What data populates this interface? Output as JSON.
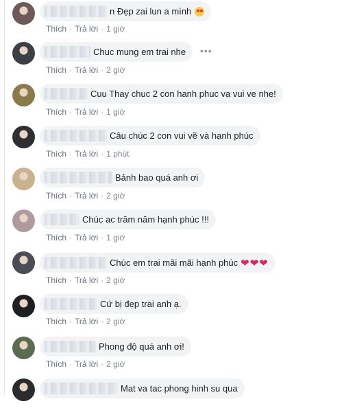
{
  "actions": {
    "like": "Thích",
    "reply": "Trả lời",
    "sep": "·"
  },
  "more_icon": "more-horizontal-icon",
  "comments": [
    {
      "text": "n Đẹp zai lun a mình",
      "time": "1 giờ",
      "blur_w": 92,
      "extra": "heart-eyes-emoji",
      "avatar": "#6d5a58"
    },
    {
      "text": "Chuc mung em trai nhe",
      "time": "2 giờ",
      "blur_w": 68,
      "avatar": "#3c3f44"
    },
    {
      "text": "Cuu Thay chuc 2 con hanh phuc va vui ve nhe!",
      "time": "1 giờ",
      "blur_w": 64,
      "avatar": "#8b7a4a"
    },
    {
      "text": "Câu chúc 2 con vui vẽ và hạnh phúc",
      "time": "1 phút",
      "blur_w": 92,
      "avatar": "#2d2f33"
    },
    {
      "text": "Bảnh bao quá anh ơi",
      "time": "2 giờ",
      "blur_w": 100,
      "avatar": "#c9b38e"
    },
    {
      "text": "Chúc ac trăm năm hạnh phúc !!!",
      "time": "1 giờ",
      "blur_w": 52,
      "avatar": "#b09aa0"
    },
    {
      "text": "Chúc em trai mãi mãi hạnh phúc",
      "time": "2 giờ",
      "blur_w": 92,
      "hearts": "❤❤❤",
      "avatar": "#4a4d55"
    },
    {
      "text": "Cứ bị đẹp trai anh ạ.",
      "time": "2 giờ",
      "blur_w": 78,
      "avatar": "#1e1f22"
    },
    {
      "text": "Phong độ quá anh ơi!",
      "time": "2 giờ",
      "blur_w": 76,
      "avatar": "#5a6b4e"
    },
    {
      "text": "Mat va tac phong hinh su qua",
      "time": "",
      "blur_w": 108,
      "avatar": "#2a2b2e"
    }
  ]
}
